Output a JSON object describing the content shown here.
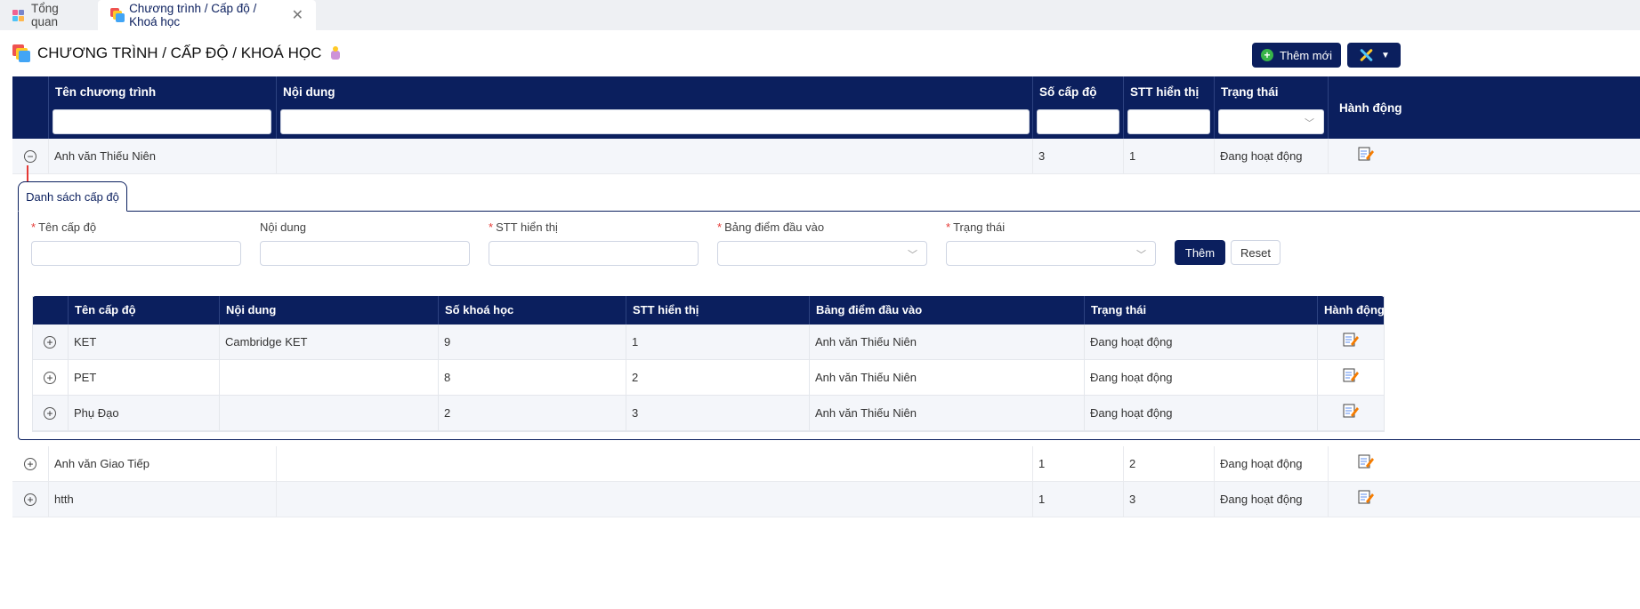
{
  "tabs": [
    {
      "label": "Tổng quan",
      "closable": false
    },
    {
      "label": "Chương trình / Cấp độ / Khoá học",
      "closable": true,
      "active": true
    }
  ],
  "page": {
    "title": "CHƯƠNG TRÌNH / CẤP ĐỘ / KHOÁ HỌC",
    "add_button": "Thêm mới"
  },
  "main_table": {
    "columns": [
      "Tên chương trình",
      "Nội dung",
      "Số cấp độ",
      "STT hiển thị",
      "Trạng thái",
      "Hành động"
    ],
    "rows": [
      {
        "name": "Anh văn Thiếu Niên",
        "content": "",
        "levels": "3",
        "order": "1",
        "status": "Đang hoạt động",
        "expanded": true
      },
      {
        "name": "Anh văn Giao Tiếp",
        "content": "",
        "levels": "1",
        "order": "2",
        "status": "Đang hoạt động",
        "expanded": false
      },
      {
        "name": "htth",
        "content": "",
        "levels": "1",
        "order": "3",
        "status": "Đang hoạt động",
        "expanded": false
      }
    ]
  },
  "detail": {
    "tab_label": "Danh sách cấp độ",
    "form": {
      "fields": [
        {
          "label": "Tên cấp độ",
          "required": true,
          "type": "text",
          "value": ""
        },
        {
          "label": "Nội dung",
          "required": false,
          "type": "text",
          "value": ""
        },
        {
          "label": "STT hiển thị",
          "required": true,
          "type": "text",
          "value": ""
        },
        {
          "label": "Bảng điểm đầu vào",
          "required": true,
          "type": "select",
          "value": ""
        },
        {
          "label": "Trạng thái",
          "required": true,
          "type": "select",
          "value": ""
        }
      ],
      "add_button": "Thêm",
      "reset_button": "Reset"
    },
    "sub_table": {
      "columns": [
        "Tên cấp độ",
        "Nội dung",
        "Số khoá học",
        "STT hiển thị",
        "Bảng điểm đầu vào",
        "Trạng thái",
        "Hành động"
      ],
      "rows": [
        {
          "name": "KET",
          "content": "Cambridge KET",
          "courses": "9",
          "order": "1",
          "score_table": "Anh văn Thiếu Niên",
          "status": "Đang hoạt động"
        },
        {
          "name": "PET",
          "content": "",
          "courses": "8",
          "order": "2",
          "score_table": "Anh văn Thiếu Niên",
          "status": "Đang hoạt động"
        },
        {
          "name": "Phụ Đạo",
          "content": "",
          "courses": "2",
          "order": "3",
          "score_table": "Anh văn Thiếu Niên",
          "status": "Đang hoạt động"
        }
      ]
    }
  },
  "icons": {
    "collapse": "minus-circle-icon",
    "expand": "plus-circle-icon",
    "edit": "edit-note-icon",
    "dropdown": "chevron-down-icon"
  },
  "colors": {
    "header_bg": "#0b1f5e",
    "required": "#e53935",
    "add_green": "#38b449"
  }
}
